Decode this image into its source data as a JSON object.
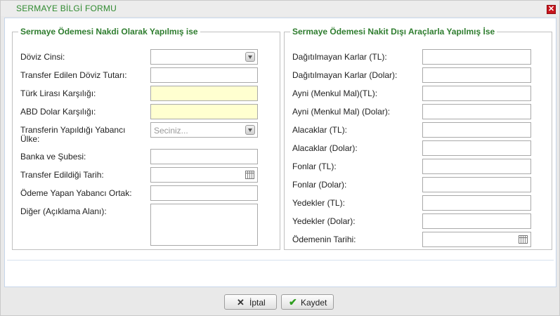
{
  "dialog": {
    "title": "SERMAYE BİLGİ FORMU",
    "close_glyph": "✕"
  },
  "left_section": {
    "legend": "Sermaye Ödemesi Nakdi Olarak Yapılmış ise",
    "fields": {
      "doviz_cinsi": {
        "label": "Döviz Cinsi:",
        "value": ""
      },
      "transfer_doviz_tutari": {
        "label": "Transfer Edilen Döviz Tutarı:",
        "value": ""
      },
      "tl_karsiligi": {
        "label": "Türk Lirası Karşılığı:",
        "value": ""
      },
      "abd_dolar_karsiligi": {
        "label": "ABD Dolar Karşılığı:",
        "value": ""
      },
      "yabanci_ulke": {
        "label_line1": "Transferin Yapıldığı Yabancı",
        "label_line2": "Ülke:",
        "value": "Seciniz..."
      },
      "banka_subesi": {
        "label": "Banka ve Şubesi:",
        "value": ""
      },
      "transfer_tarihi": {
        "label": "Transfer Edildiği Tarih:",
        "value": ""
      },
      "odeme_yapan_ortak": {
        "label": "Ödeme Yapan Yabancı Ortak:",
        "value": ""
      },
      "diger": {
        "label": "Diğer (Açıklama Alanı):",
        "value": ""
      }
    }
  },
  "right_section": {
    "legend": "Sermaye Ödemesi Nakit Dışı Araçlarla Yapılmış İse",
    "fields": [
      {
        "label": "Dağıtılmayan Karlar (TL):",
        "value": ""
      },
      {
        "label": "Dağıtılmayan Karlar (Dolar):",
        "value": ""
      },
      {
        "label": "Ayni (Menkul Mal)(TL):",
        "value": ""
      },
      {
        "label": "Ayni (Menkul Mal) (Dolar):",
        "value": ""
      },
      {
        "label": "Alacaklar (TL):",
        "value": ""
      },
      {
        "label": "Alacaklar (Dolar):",
        "value": ""
      },
      {
        "label": "Fonlar (TL):",
        "value": ""
      },
      {
        "label": "Fonlar (Dolar):",
        "value": ""
      },
      {
        "label": "Yedekler (TL):",
        "value": ""
      },
      {
        "label": "Yedekler (Dolar):",
        "value": ""
      },
      {
        "label": "Ödemenin Tarihi:",
        "value": ""
      }
    ]
  },
  "footer": {
    "cancel_label": "İptal",
    "cancel_icon": "x-icon",
    "save_label": "Kaydet",
    "save_icon": "checkmark-icon"
  },
  "colors": {
    "title_green": "#2f8a2f",
    "legend_green": "#2f7d2f",
    "close_red": "#c8141c",
    "readonly_yellow": "#ffffd0",
    "save_check_green": "#2e9e1f"
  }
}
